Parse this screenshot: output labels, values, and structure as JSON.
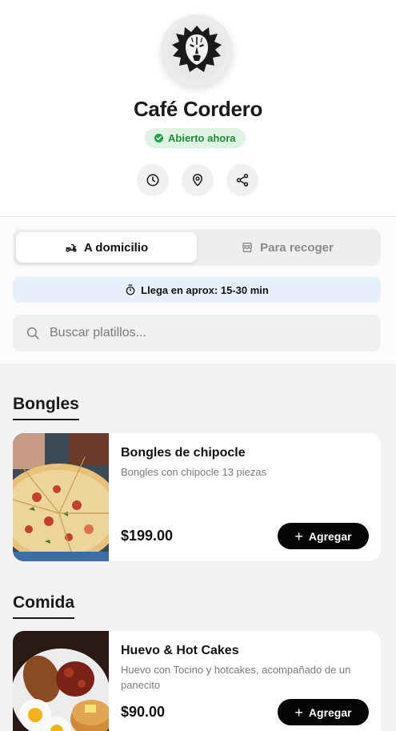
{
  "store": {
    "name": "Café Cordero",
    "status": "Abierto ahora",
    "status_color": "#24a148",
    "logo_icon": "lion-head-logo"
  },
  "actions": [
    {
      "icon": "clock-icon"
    },
    {
      "icon": "map-pin-icon"
    },
    {
      "icon": "share-icon"
    }
  ],
  "order_mode": {
    "delivery_label": "A domicilio",
    "pickup_label": "Para recoger",
    "selected": "delivery"
  },
  "eta": {
    "text": "Llega en aprox: 15-30 min"
  },
  "search": {
    "placeholder": "Buscar platillos..."
  },
  "sections": [
    {
      "title": "Bongles",
      "items": [
        {
          "name": "Bongles de chipocle",
          "description": "Bongles con chipocle 13 piezas",
          "price": "$199.00",
          "add_label": "Agregar"
        }
      ]
    },
    {
      "title": "Comida",
      "items": [
        {
          "name": "Huevo & Hot Cakes",
          "description": "Huevo con Tocino y hotcakes, acompañado de un panecito",
          "price": "$90.00",
          "add_label": "Agregar"
        }
      ]
    }
  ]
}
